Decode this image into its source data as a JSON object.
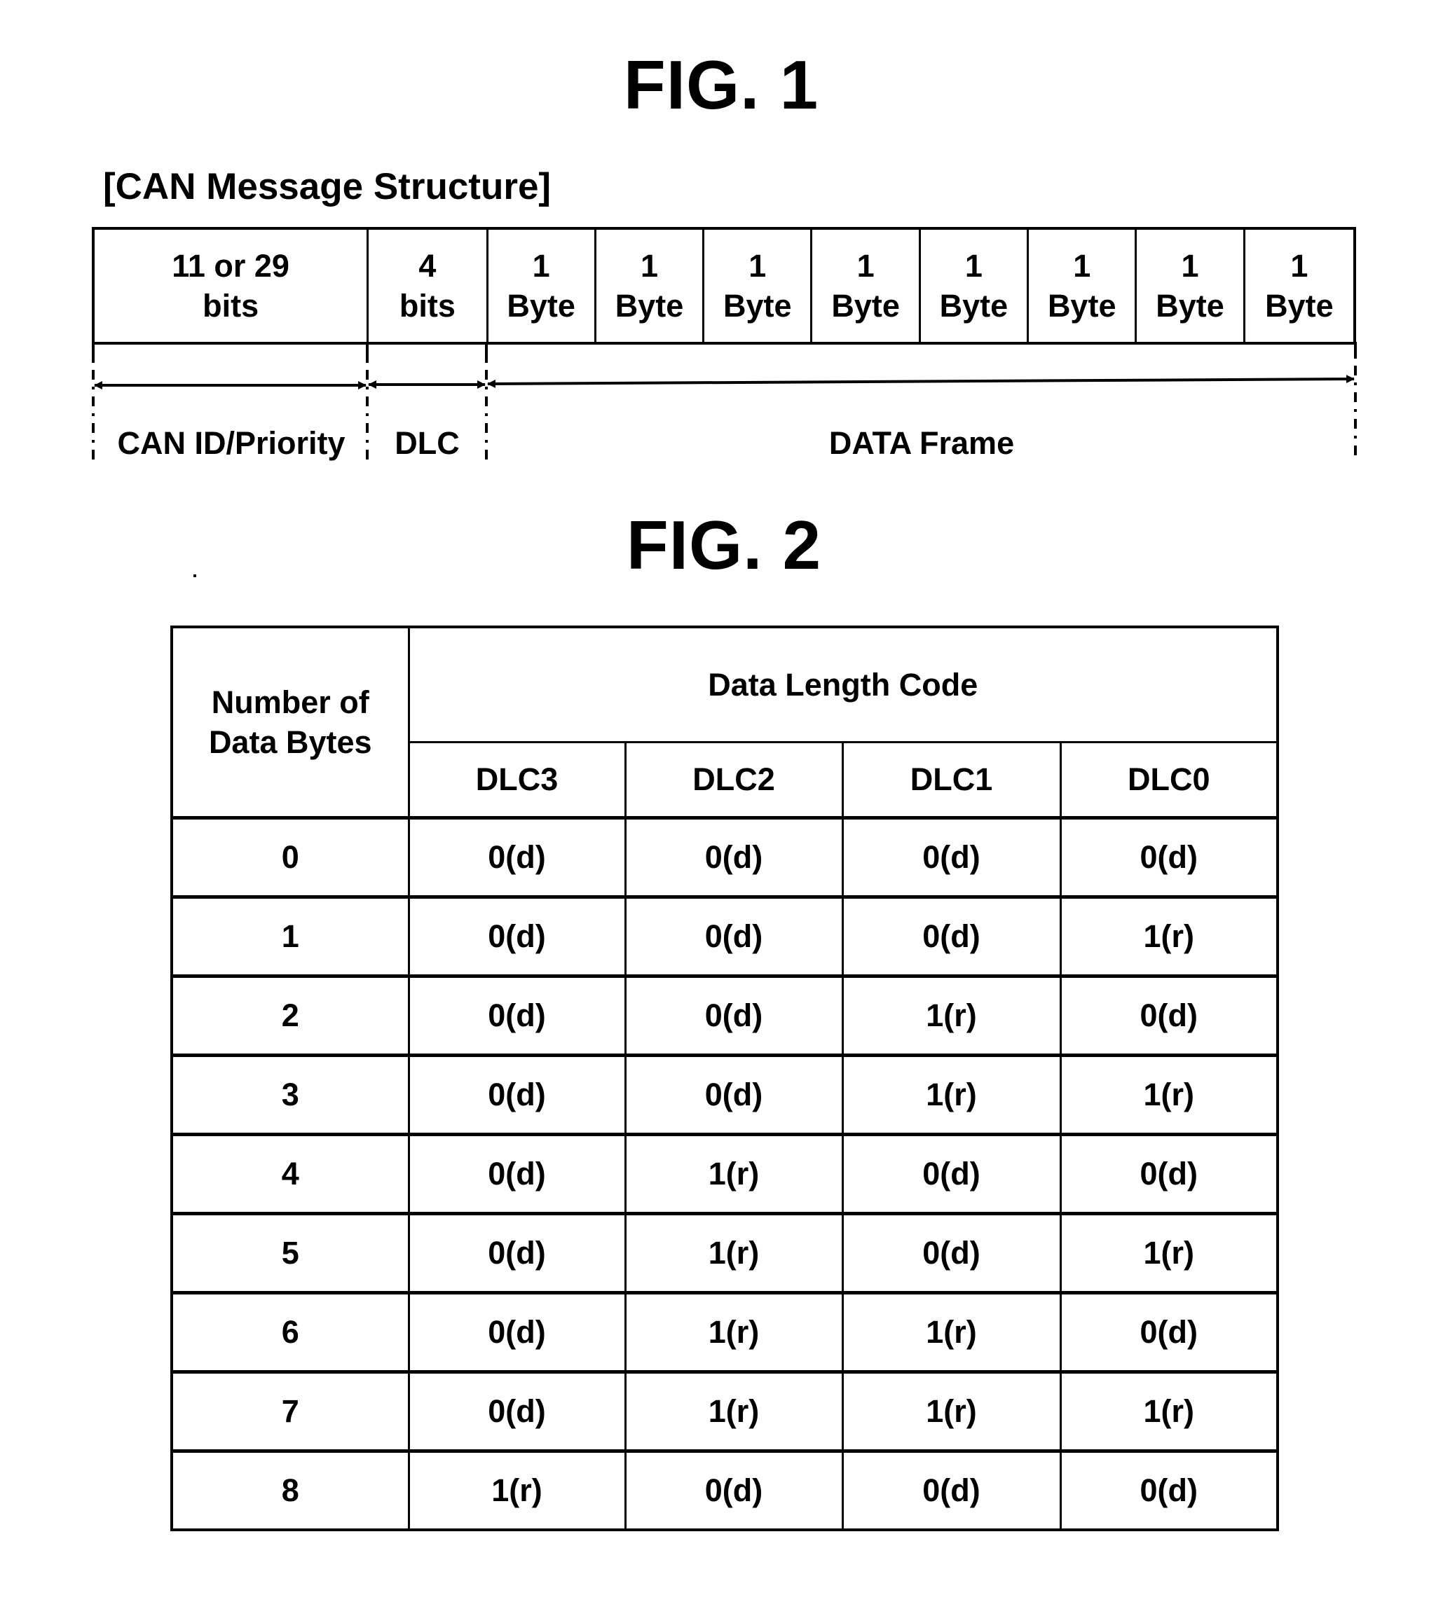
{
  "fig1": {
    "title": "FIG. 1",
    "caption": "[CAN Message Structure]",
    "fields": [
      {
        "line1": "11 or 29",
        "line2": "bits"
      },
      {
        "line1": "4",
        "line2": "bits"
      },
      {
        "line1": "1",
        "line2": "Byte"
      },
      {
        "line1": "1",
        "line2": "Byte"
      },
      {
        "line1": "1",
        "line2": "Byte"
      },
      {
        "line1": "1",
        "line2": "Byte"
      },
      {
        "line1": "1",
        "line2": "Byte"
      },
      {
        "line1": "1",
        "line2": "Byte"
      },
      {
        "line1": "1",
        "line2": "Byte"
      },
      {
        "line1": "1",
        "line2": "Byte"
      }
    ],
    "segments": {
      "id": "CAN ID/Priority",
      "dlc": "DLC",
      "data": "DATA Frame"
    }
  },
  "fig2": {
    "title": "FIG. 2",
    "header": {
      "left_line1": "Number of",
      "left_line2": "Data Bytes",
      "group": "Data Length Code",
      "columns": [
        "DLC3",
        "DLC2",
        "DLC1",
        "DLC0"
      ]
    },
    "rows": [
      {
        "bytes": "0",
        "dlc": [
          "0(d)",
          "0(d)",
          "0(d)",
          "0(d)"
        ]
      },
      {
        "bytes": "1",
        "dlc": [
          "0(d)",
          "0(d)",
          "0(d)",
          "1(r)"
        ]
      },
      {
        "bytes": "2",
        "dlc": [
          "0(d)",
          "0(d)",
          "1(r)",
          "0(d)"
        ]
      },
      {
        "bytes": "3",
        "dlc": [
          "0(d)",
          "0(d)",
          "1(r)",
          "1(r)"
        ]
      },
      {
        "bytes": "4",
        "dlc": [
          "0(d)",
          "1(r)",
          "0(d)",
          "0(d)"
        ]
      },
      {
        "bytes": "5",
        "dlc": [
          "0(d)",
          "1(r)",
          "0(d)",
          "1(r)"
        ]
      },
      {
        "bytes": "6",
        "dlc": [
          "0(d)",
          "1(r)",
          "1(r)",
          "0(d)"
        ]
      },
      {
        "bytes": "7",
        "dlc": [
          "0(d)",
          "1(r)",
          "1(r)",
          "1(r)"
        ]
      },
      {
        "bytes": "8",
        "dlc": [
          "1(r)",
          "0(d)",
          "0(d)",
          "0(d)"
        ]
      }
    ]
  }
}
